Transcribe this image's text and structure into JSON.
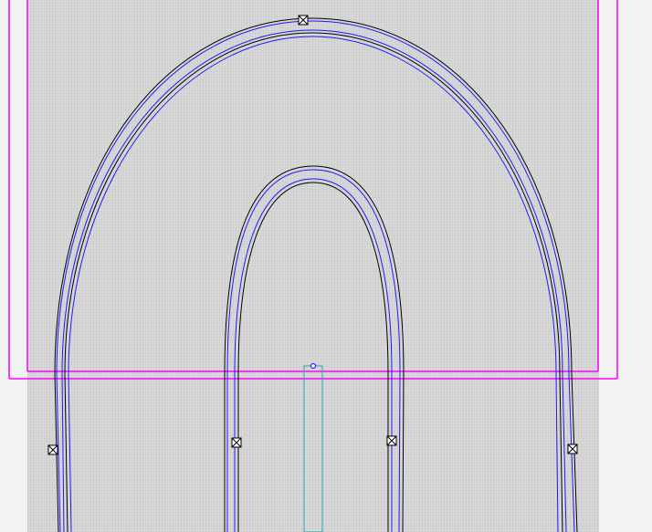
{
  "editor": {
    "tool": "glyph-outline-editor",
    "show_grid": true,
    "show_metrics_box": true
  },
  "colors": {
    "background": "#f2f2f2",
    "grid_fill": "#d6d6d6",
    "grid_line": "#bdbdbd",
    "metrics_box": "#ff00ff",
    "outline_black": "#000000",
    "outline_blue": "#1a1aff",
    "stem_guide": "#2aa6a6",
    "anchor": "#2020ff"
  },
  "glyph": {
    "outer_outline": "outer-contour",
    "inner_outline": "counter-contour",
    "control_points": [
      {
        "name": "outer-top-node"
      },
      {
        "name": "outer-left-node"
      },
      {
        "name": "outer-right-node"
      },
      {
        "name": "inner-left-node"
      },
      {
        "name": "inner-right-node"
      }
    ],
    "anchor": {
      "name": "stem-anchor"
    }
  }
}
